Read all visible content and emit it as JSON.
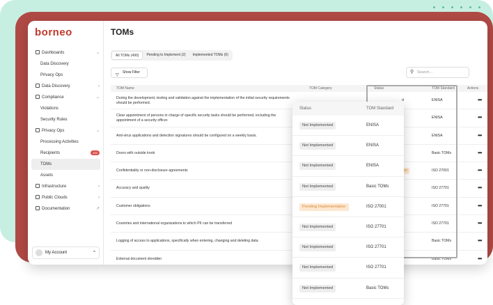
{
  "brand": {
    "logo": "borneo"
  },
  "sidebar": {
    "items": [
      {
        "label": "Dashboards",
        "level": "top",
        "icon": "grid-icon",
        "chevron": "⌄"
      },
      {
        "label": "Data Discovery",
        "level": "sub"
      },
      {
        "label": "Privacy Ops",
        "level": "sub"
      },
      {
        "label": "Data Discovery",
        "level": "top",
        "icon": "discovery-icon",
        "chevron": "›"
      },
      {
        "label": "Compliance",
        "level": "top",
        "icon": "compliance-icon",
        "chevron": "⌄"
      },
      {
        "label": "Violations",
        "level": "sub"
      },
      {
        "label": "Security Rules",
        "level": "sub"
      },
      {
        "label": "Privacy Ops",
        "level": "top",
        "icon": "privacy-icon",
        "chevron": "⌄"
      },
      {
        "label": "Processing Activities",
        "level": "sub"
      },
      {
        "label": "Recipients",
        "level": "sub",
        "badge": "492"
      },
      {
        "label": "TOMs",
        "level": "sub",
        "active": true
      },
      {
        "label": "Assets",
        "level": "sub"
      },
      {
        "label": "Infrastructure",
        "level": "top",
        "icon": "infrastructure-icon",
        "chevron": "›"
      },
      {
        "label": "Public Clouds",
        "level": "top",
        "icon": "cloud-icon",
        "chevron": "›"
      },
      {
        "label": "Documentation",
        "level": "top",
        "icon": "doc-icon",
        "chevron": "↗"
      }
    ],
    "account": {
      "label": "My Account",
      "chevron": "^"
    }
  },
  "page": {
    "title": "TOMs"
  },
  "tabs": [
    {
      "label": "All TOMs (490)",
      "active": true
    },
    {
      "label": "Pending to Implement (2)"
    },
    {
      "label": "Implemented TOMs (6)"
    }
  ],
  "toolbar": {
    "filter_label": "Show Filter",
    "search_placeholder": "Search..."
  },
  "table": {
    "headers": {
      "name": "TOM Name",
      "category": "TOM Category",
      "status": "Status",
      "standard": "TOM Standard",
      "actions": "Actions"
    },
    "rows": [
      {
        "name": "During the development, testing and validation against the implementation of the initial security requirements should be performed.",
        "status": "d",
        "standard": "ENISA"
      },
      {
        "name": "Clear appointment of persons in charge of specific security tasks should be performed, including the appointment of a security officer.",
        "status": "d",
        "standard": "ENISA"
      },
      {
        "name": "Anti-virus applications and detection signatures should be configured on a weekly basis.",
        "status": "d",
        "standard": "ENISA"
      },
      {
        "name": "Doors with outside knob",
        "status": "d",
        "standard": "Basic TOMs"
      },
      {
        "name": "Confidentiality or non-disclosure agreements",
        "status": "entation",
        "standard": "ISO 27001",
        "pending": true
      },
      {
        "name": "Accuracy and quality",
        "status": "d",
        "standard": "ISO 27701"
      },
      {
        "name": "Customer obligations",
        "status": "d",
        "standard": "ISO 27701"
      },
      {
        "name": "Countries and international organizations to which PII can be transferred",
        "status": "d",
        "standard": "ISO 27701"
      },
      {
        "name": "Logging of access to applications, specifically when entering, changing and deleting data",
        "status": "d",
        "standard": "Basic TOMs"
      },
      {
        "name": "External document shredder",
        "status": "d",
        "standard": "Basic TOMs"
      }
    ],
    "action_glyph": "•••"
  },
  "popup": {
    "headers": {
      "status": "Status",
      "standard": "TOM Standard"
    },
    "rows": [
      {
        "status": "Not Implemented",
        "standard": "ENISA"
      },
      {
        "status": "Not Implemented",
        "standard": "ENISA"
      },
      {
        "status": "Not Implemented",
        "standard": "ENISA"
      },
      {
        "status": "Not Implemented",
        "standard": "Basic TOMs"
      },
      {
        "status": "Pending Implementation",
        "standard": "ISO 27001",
        "pending": true
      },
      {
        "status": "Not Implemented",
        "standard": "ISO 27701"
      },
      {
        "status": "Not Implemented",
        "standard": "ISO 27701"
      },
      {
        "status": "Not Implemented",
        "standard": "ISO 27701"
      },
      {
        "status": "Not Implemented",
        "standard": "Basic TOMs"
      },
      {
        "status": "Not Implemented",
        "standard": "Basic TOMs"
      }
    ]
  },
  "colors": {
    "brand": "#c0392b",
    "pending_bg": "#fde7d0",
    "pending_fg": "#d98b3a",
    "mint": "#c7efe1",
    "red": "#b04a45"
  }
}
